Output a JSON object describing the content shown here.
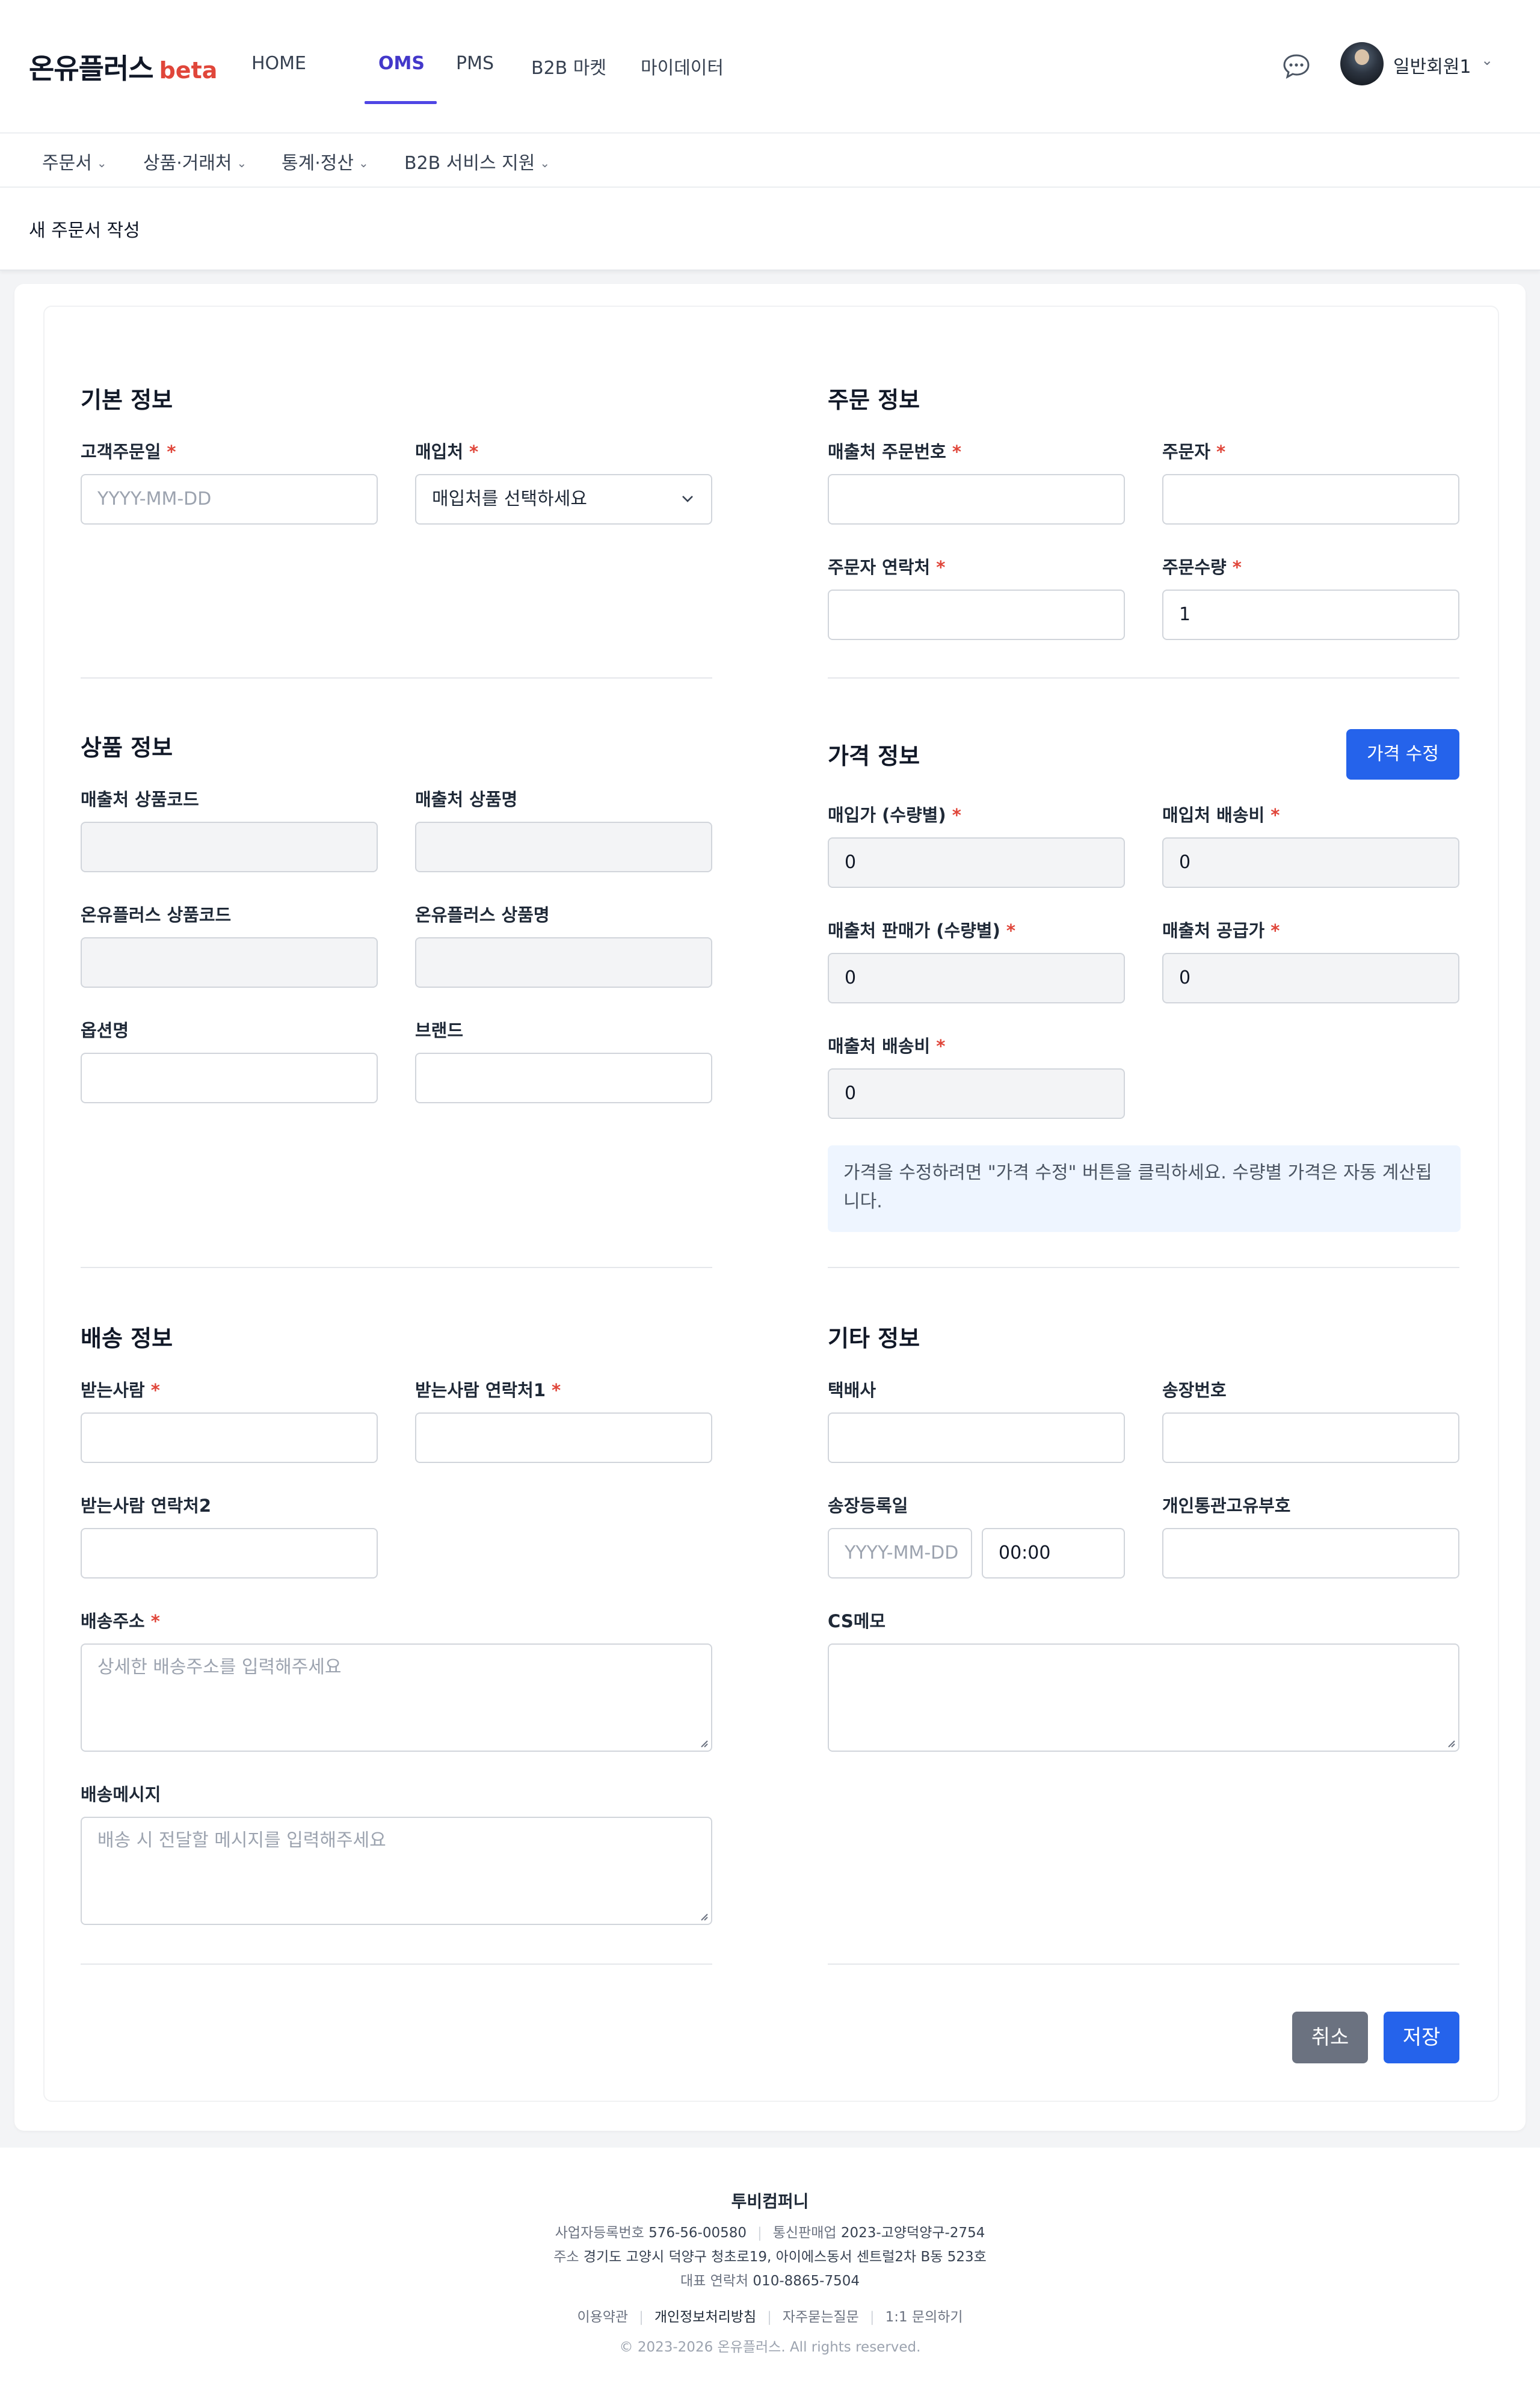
{
  "header": {
    "logo_text": "온유플러스",
    "logo_badge": "beta",
    "nav": [
      "HOME",
      "OMS",
      "PMS",
      "B2B 마켓",
      "마이데이터"
    ],
    "active_nav": "OMS",
    "user_name": "일반회원1"
  },
  "subnav": {
    "items": [
      "주문서",
      "상품·거래처",
      "통계·정산",
      "B2B 서비스 지원"
    ]
  },
  "page": {
    "title": "새 주문서 작성"
  },
  "sections": {
    "basic": {
      "title": "기본 정보",
      "order_date_label": "고객주문일",
      "order_date_placeholder": "YYYY-MM-DD",
      "supplier_label": "매입처",
      "supplier_value": "매입처를 선택하세요"
    },
    "order": {
      "title": "주문 정보",
      "sales_order_no_label": "매출처 주문번호",
      "orderer_label": "주문자",
      "orderer_phone_label": "주문자 연락처",
      "qty_label": "주문수량",
      "qty_value": "1"
    },
    "product": {
      "title": "상품 정보",
      "sales_code_label": "매출처 상품코드",
      "sales_name_label": "매출처 상품명",
      "onyu_code_label": "온유플러스 상품코드",
      "onyu_name_label": "온유플러스 상품명",
      "option_label": "옵션명",
      "brand_label": "브랜드"
    },
    "price": {
      "title": "가격 정보",
      "edit_button": "가격 수정",
      "purchase_price_label": "매입가 (수량별)",
      "purchase_price_value": "0",
      "supplier_shipping_label": "매입처 배송비",
      "supplier_shipping_value": "0",
      "sales_price_label": "매출처 판매가 (수량별)",
      "sales_price_value": "0",
      "sales_supply_label": "매출처 공급가",
      "sales_supply_value": "0",
      "sales_shipping_label": "매출처 배송비",
      "sales_shipping_value": "0",
      "notice": "가격을 수정하려면 \"가격 수정\" 버튼을 클릭하세요. 수량별 가격은 자동 계산됩니다."
    },
    "shipping": {
      "title": "배송 정보",
      "recipient_label": "받는사람",
      "recipient_phone1_label": "받는사람 연락처1",
      "recipient_phone2_label": "받는사람 연락처2",
      "address_label": "배송주소",
      "address_placeholder": "상세한 배송주소를 입력해주세요",
      "message_label": "배송메시지",
      "message_placeholder": "배송 시 전달할 메시지를 입력해주세요"
    },
    "etc": {
      "title": "기타 정보",
      "courier_label": "택배사",
      "invoice_label": "송장번호",
      "invoice_date_label": "송장등록일",
      "invoice_date_placeholder": "YYYY-MM-DD",
      "invoice_time_value": "00:00",
      "customs_label": "개인통관고유부호",
      "cs_memo_label": "CS메모"
    }
  },
  "actions": {
    "cancel": "취소",
    "save": "저장"
  },
  "footer": {
    "company": "투비컴퍼니",
    "biz_no_label": "사업자등록번호",
    "biz_no": "576-56-00580",
    "mail_order_label": "통신판매업",
    "mail_order": "2023-고양덕양구-2754",
    "address_label": "주소",
    "address": "경기도 고양시 덕양구 청초로19, 아이에스동서 센트럴2차 B동 523호",
    "phone_label": "대표 연락처",
    "phone": "010-8865-7504",
    "links": [
      "이용약관",
      "개인정보처리방침",
      "자주묻는질문",
      "1:1 문의하기"
    ],
    "copyright": "© 2023-2026 온유플러스. All rights reserved."
  },
  "colors": {
    "brand_blue": "#2563eb",
    "nav_active": "#4f46e5",
    "required": "#e0463a",
    "beta": "#e0463a"
  }
}
